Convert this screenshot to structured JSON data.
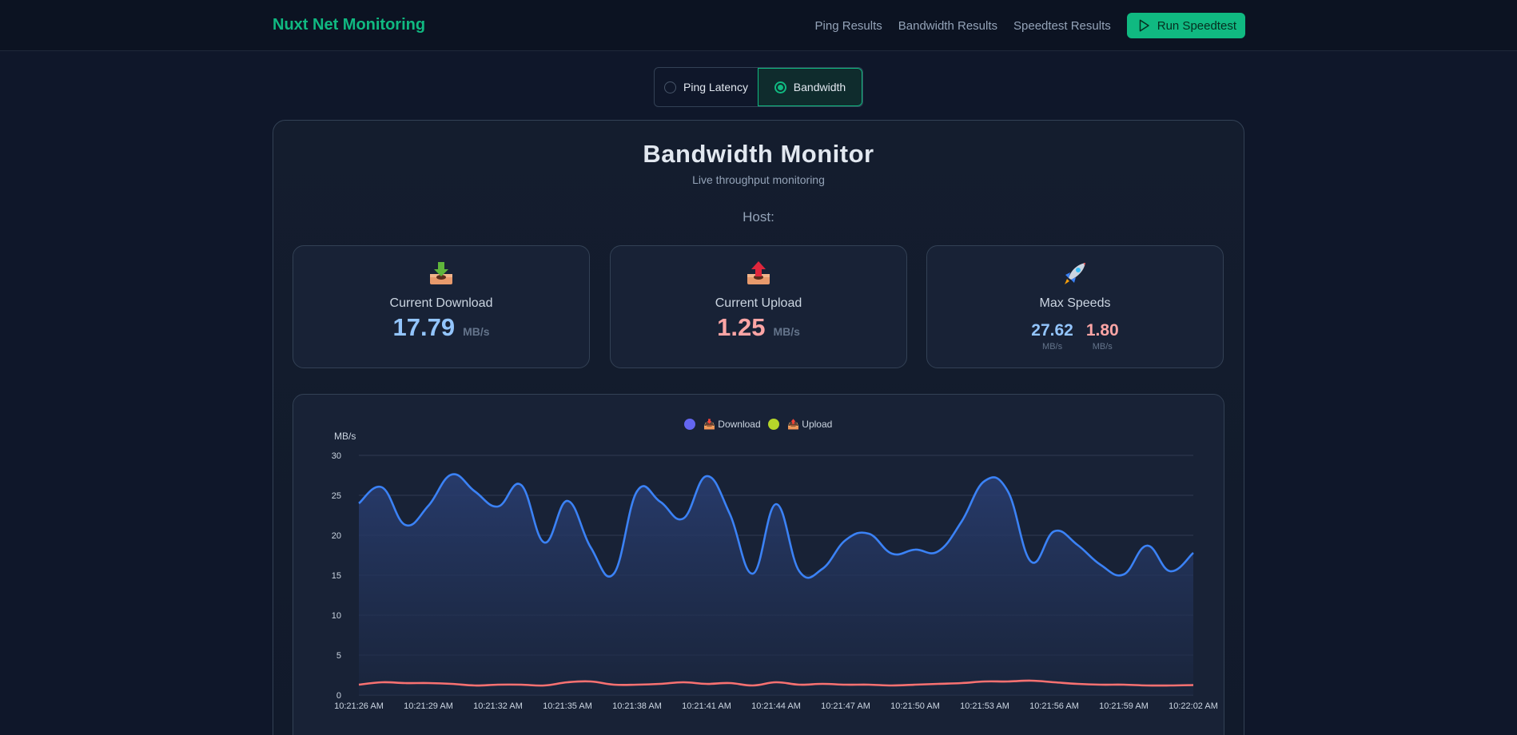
{
  "header": {
    "brand": "Nuxt Net Monitoring",
    "nav": [
      "Ping Results",
      "Bandwidth Results",
      "Speedtest Results"
    ],
    "run_button": "Run Speedtest"
  },
  "toggle": {
    "options": [
      "Ping Latency",
      "Bandwidth"
    ],
    "selected": "Bandwidth"
  },
  "monitor": {
    "title": "Bandwidth Monitor",
    "subtitle": "Live throughput monitoring",
    "host_label": "Host:"
  },
  "cards": {
    "download": {
      "label": "Current Download",
      "value": "17.79",
      "unit": "MB/s",
      "icon": "download-tray-icon"
    },
    "upload": {
      "label": "Current Upload",
      "value": "1.25",
      "unit": "MB/s",
      "icon": "upload-tray-icon"
    },
    "max": {
      "label": "Max Speeds",
      "download": "27.62",
      "upload": "1.80",
      "unit": "MB/s",
      "icon": "rocket-icon"
    }
  },
  "colors": {
    "accent": "#10b981",
    "download": "#93c5fd",
    "upload": "#fca5a5",
    "download_line": "#3b82f6",
    "upload_line": "#f87171"
  },
  "chart_data": {
    "type": "line",
    "ylabel": "MB/s",
    "ylim": [
      0,
      30
    ],
    "yticks": [
      0,
      5,
      10,
      15,
      20,
      25,
      30
    ],
    "grid": true,
    "legend_position": "top-center",
    "legend": [
      "📥 Download",
      "📤 Upload"
    ],
    "legend_colors": [
      "#6366f1",
      "#b5d52a"
    ],
    "x_tick_labels": [
      "10:21:26 AM",
      "10:21:29 AM",
      "10:21:32 AM",
      "10:21:35 AM",
      "10:21:38 AM",
      "10:21:41 AM",
      "10:21:44 AM",
      "10:21:47 AM",
      "10:21:50 AM",
      "10:21:53 AM",
      "10:21:56 AM",
      "10:21:59 AM",
      "10:22:02 AM"
    ],
    "x_seconds_per_sample": 1,
    "series": [
      {
        "name": "📥 Download",
        "values": [
          24.0,
          26.0,
          21.3,
          23.7,
          27.6,
          25.5,
          23.6,
          26.3,
          19.1,
          24.3,
          18.5,
          15.2,
          25.5,
          24.2,
          22.1,
          27.4,
          22.7,
          15.2,
          23.9,
          15.5,
          15.8,
          19.4,
          20.2,
          17.7,
          18.2,
          18.0,
          21.7,
          26.8,
          25.5,
          16.7,
          20.5,
          18.8,
          16.3,
          15.1,
          18.7,
          15.5,
          17.8
        ]
      },
      {
        "name": "📤 Upload",
        "values": [
          1.3,
          1.6,
          1.5,
          1.5,
          1.4,
          1.2,
          1.3,
          1.3,
          1.2,
          1.6,
          1.7,
          1.3,
          1.3,
          1.4,
          1.6,
          1.4,
          1.5,
          1.2,
          1.6,
          1.3,
          1.4,
          1.3,
          1.3,
          1.2,
          1.3,
          1.4,
          1.5,
          1.7,
          1.7,
          1.8,
          1.6,
          1.4,
          1.3,
          1.3,
          1.2,
          1.2,
          1.25
        ]
      }
    ]
  }
}
